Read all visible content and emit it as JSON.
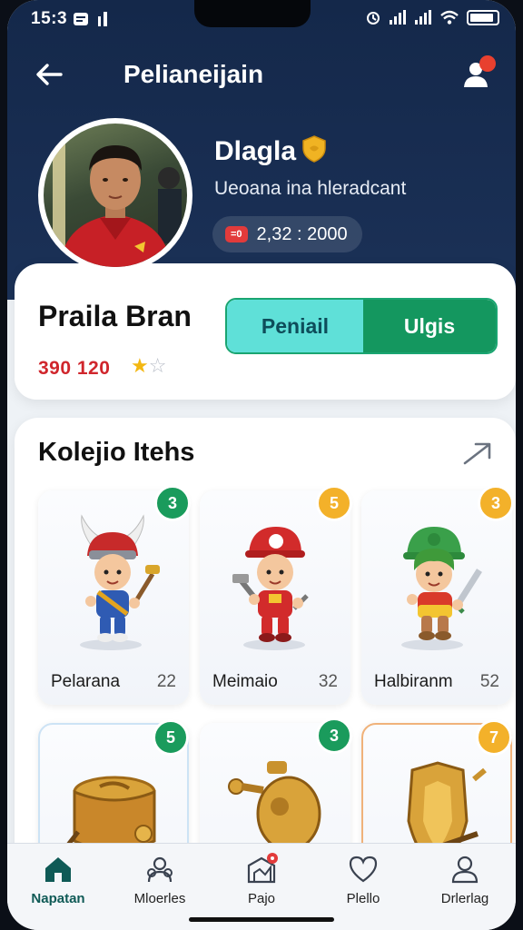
{
  "status_bar": {
    "time": "15:3",
    "left_icons": "🖂 ▮"
  },
  "header": {
    "title": "Pelianeijain"
  },
  "profile": {
    "name": "Dlagla",
    "subtitle": "Ueoana ina hleradcant",
    "stat_badge": "=0",
    "stat_value": "2,32 : 2000"
  },
  "summary": {
    "title": "Praila Bran",
    "score": "390 120",
    "rating": 1,
    "rating_max": 2,
    "toggle": {
      "left": "Peniail",
      "right": "Ulgis"
    }
  },
  "collection": {
    "title": "Kolejio Itehs",
    "items": [
      {
        "name": "Pelarana",
        "count": "22",
        "badge": "3",
        "badge_color": "#1a9b5c"
      },
      {
        "name": "Meimaio",
        "count": "32",
        "badge": "5",
        "badge_color": "#f3b12a"
      },
      {
        "name": "Halbiranm",
        "count": "52",
        "badge": "3",
        "badge_color": "#f3b12a"
      },
      {
        "name": "",
        "count": "",
        "badge": "5",
        "badge_color": "#1a9b5c"
      },
      {
        "name": "",
        "count": "",
        "badge": "3",
        "badge_color": "#1a9b5c"
      },
      {
        "name": "",
        "count": "",
        "badge": "7",
        "badge_color": "#f3b12a"
      }
    ]
  },
  "nav": [
    {
      "label": "Napatan",
      "icon": "home-icon"
    },
    {
      "label": "Mloerles",
      "icon": "users-icon"
    },
    {
      "label": "Pajo",
      "icon": "store-icon"
    },
    {
      "label": "Plello",
      "icon": "heart-icon"
    },
    {
      "label": "Drlerlag",
      "icon": "user-icon"
    }
  ]
}
